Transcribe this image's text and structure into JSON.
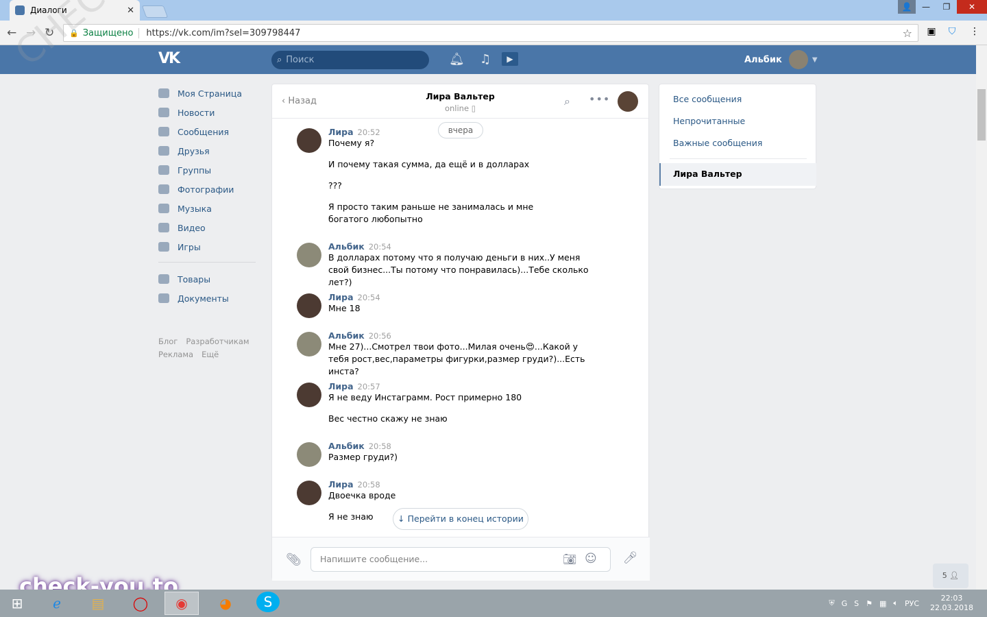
{
  "browser": {
    "tab_title": "Диалоги",
    "secure_label": "Защищено",
    "url": "https://vk.com/im?sel=309798447"
  },
  "vk": {
    "logo": "VK",
    "search_placeholder": "Поиск",
    "user_name": "Альбик"
  },
  "sidebar": {
    "items": [
      {
        "label": "Моя Страница",
        "icon": "home-icon"
      },
      {
        "label": "Новости",
        "icon": "news-icon"
      },
      {
        "label": "Сообщения",
        "icon": "messages-icon"
      },
      {
        "label": "Друзья",
        "icon": "friends-icon"
      },
      {
        "label": "Группы",
        "icon": "groups-icon"
      },
      {
        "label": "Фотографии",
        "icon": "photos-icon"
      },
      {
        "label": "Музыка",
        "icon": "music-icon"
      },
      {
        "label": "Видео",
        "icon": "video-icon"
      },
      {
        "label": "Игры",
        "icon": "games-icon"
      }
    ],
    "items2": [
      {
        "label": "Товары",
        "icon": "goods-icon"
      },
      {
        "label": "Документы",
        "icon": "documents-icon"
      }
    ],
    "footer": {
      "blog": "Блог",
      "dev": "Разработчикам",
      "ads": "Реклама",
      "more": "Ещё"
    }
  },
  "dialog": {
    "back_label": "Назад",
    "contact_name": "Лира Вальтер",
    "contact_status": "online",
    "date_chip": "вчера",
    "jump_label": "Перейти в конец истории",
    "compose_placeholder": "Напишите сообщение...",
    "messages": [
      {
        "author": "Лира",
        "time": "20:52",
        "lines": [
          "Почему я?",
          "И почему такая сумма, да ещё и в долларах",
          "???",
          "Я просто таким раньше не занималась и мне богатого любопытно"
        ]
      },
      {
        "author": "Альбик",
        "time": "20:54",
        "lines": [
          "В долларах потому что я получаю деньги в них..У меня свой бизнес...Ты потому что понравилась)...Тебе сколько лет?)"
        ]
      },
      {
        "author": "Лира",
        "time": "20:54",
        "lines": [
          "Мне 18"
        ]
      },
      {
        "author": "Альбик",
        "time": "20:56",
        "lines": [
          "Мне 27)...Смотрел твои фото...Милая очень😍...Какой у тебя рост,вес,параметры фигурки,размер груди?)...Есть инста?"
        ]
      },
      {
        "author": "Лира",
        "time": "20:57",
        "lines": [
          "Я не веду Инстаграмм. Рост примерно 180",
          "Вес честно скажу не знаю"
        ]
      },
      {
        "author": "Альбик",
        "time": "20:58",
        "lines": [
          "Размер груди?)"
        ]
      },
      {
        "author": "Лира",
        "time": "20:58",
        "lines": [
          "Двоечка вроде",
          "Я не знаю"
        ]
      }
    ]
  },
  "right_panel": {
    "all": "Все сообщения",
    "unread": "Непрочитанные",
    "important": "Важные сообщения",
    "active_chat": "Лира Вальтер"
  },
  "friends_online": "5",
  "overlay": {
    "brand": "check-you.to",
    "watermark": "CHECK-YOU.ME"
  },
  "taskbar": {
    "lang": "РУС",
    "time": "22:03",
    "date": "22.03.2018"
  }
}
